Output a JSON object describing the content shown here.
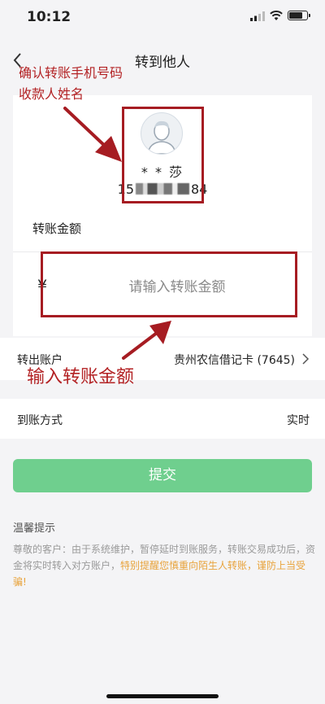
{
  "status_bar": {
    "time": "10:12"
  },
  "nav": {
    "title": "转到他人"
  },
  "recipient": {
    "name": "* * 莎",
    "phone_prefix": "15",
    "phone_suffix": "84"
  },
  "amount": {
    "label": "转账金额",
    "currency_symbol": "¥",
    "placeholder": "请输入转账金额"
  },
  "transfer_account": {
    "label": "转出账户",
    "value": "贵州农信借记卡 (7645)"
  },
  "arrival_method": {
    "label": "到账方式",
    "value": "实时"
  },
  "submit": {
    "label": "提交"
  },
  "tips": {
    "title": "温馨提示",
    "text": "尊敬的客户：由于系统维护，暂停延时到账服务，转账交易成功后，资金将实时转入对方账户，",
    "warning": "特别提醒您慎重向陌生人转账，谨防上当受骗!"
  },
  "annotations": {
    "confirm_line1": "确认转账手机号码",
    "confirm_line2": "收款人姓名",
    "input_amount": "输入转账金额"
  },
  "colors": {
    "accent_green": "#6fcf8e",
    "annotation_red": "#b32224",
    "warning_orange": "#e8a33b"
  }
}
